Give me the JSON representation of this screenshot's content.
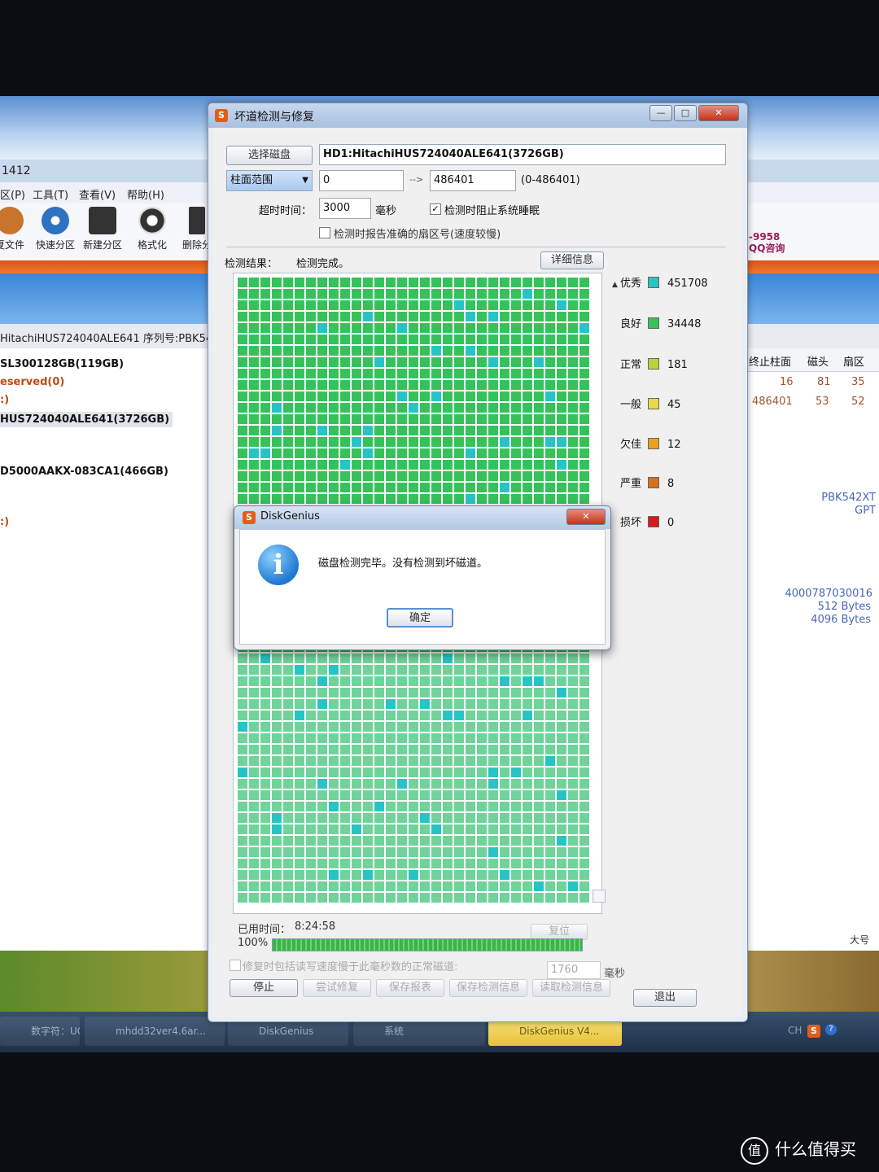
{
  "background_app": {
    "title_fragment": "1412",
    "menu": [
      "区(P)",
      "工具(T)",
      "查看(V)",
      "帮助(H)"
    ],
    "toolbar": [
      "夏文件",
      "快速分区",
      "新建分区",
      "格式化",
      "删除分"
    ],
    "disk_info": "HitachiHUS724040ALE641  序列号:PBK542",
    "tree": [
      "SL300128GB(119GB)",
      "eserved(0)",
      ":)",
      "HUS724040ALE641(3726GB)",
      "D5000AAKX-083CA1(466GB)",
      ":)"
    ],
    "ad_text": "-9958\nQQ咨询",
    "table_headers": [
      "终止柱面",
      "磁头",
      "扇区"
    ],
    "table_rows": [
      [
        "16",
        "81",
        "35"
      ],
      [
        "486401",
        "53",
        "52"
      ]
    ],
    "side_values": [
      "PBK542XT",
      "GPT",
      "4000787030016",
      "512 Bytes",
      "4096 Bytes",
      "大号"
    ]
  },
  "dialog": {
    "title": "坏道检测与修复",
    "select_disk_button": "选择磁盘",
    "disk_name": "HD1:HitachiHUS724040ALE641(3726GB)",
    "range_type": "柱面范围",
    "range_start": "0",
    "arrow": "-->",
    "range_end": "486401",
    "range_hint": "(0-486401)",
    "timeout_label": "超时时间：",
    "timeout_value": "3000",
    "timeout_unit": "毫秒",
    "prevent_sleep_label": "检测时阻止系统睡眠",
    "report_sector_label": "检测时报告准确的扇区号(速度较慢)",
    "result_label": "检测结果：",
    "result_value": "检测完成。",
    "details_button": "详细信息",
    "legend": [
      {
        "label": "优秀",
        "count": "451708",
        "color": "#27c4c4"
      },
      {
        "label": "良好",
        "count": "34448",
        "color": "#36c25a"
      },
      {
        "label": "正常",
        "count": "181",
        "color": "#b7d53a"
      },
      {
        "label": "一般",
        "count": "45",
        "color": "#e9d84a"
      },
      {
        "label": "欠佳",
        "count": "12",
        "color": "#e8a21c"
      },
      {
        "label": "严重",
        "count": "8",
        "color": "#d9701c"
      },
      {
        "label": "损坏",
        "count": "0",
        "color": "#d01c1c"
      }
    ],
    "elapsed_label": "已用时间：",
    "elapsed_value": "8:24:58",
    "progress_text": "100%",
    "progress_value": 1.0,
    "reset_button": "复位",
    "repair_note": "修复时包括读写速度慢于此毫秒数的正常磁道:",
    "repair_ms": "1760",
    "repair_unit": "毫秒",
    "buttons": [
      "停止",
      "尝试修复",
      "保存报表",
      "保存检测信息",
      "读取检测信息",
      "退出"
    ]
  },
  "popup": {
    "title": "DiskGenius",
    "message": "磁盘检测完毕。没有检测到坏磁道。",
    "ok_button": "确定"
  },
  "taskbar": {
    "items": [
      "数字符：UC城...",
      "mhdd32ver4.6ar...",
      "DiskGenius",
      "系统",
      "DiskGenius V4..."
    ],
    "tray": "CH"
  },
  "watermark": "什么值得买"
}
